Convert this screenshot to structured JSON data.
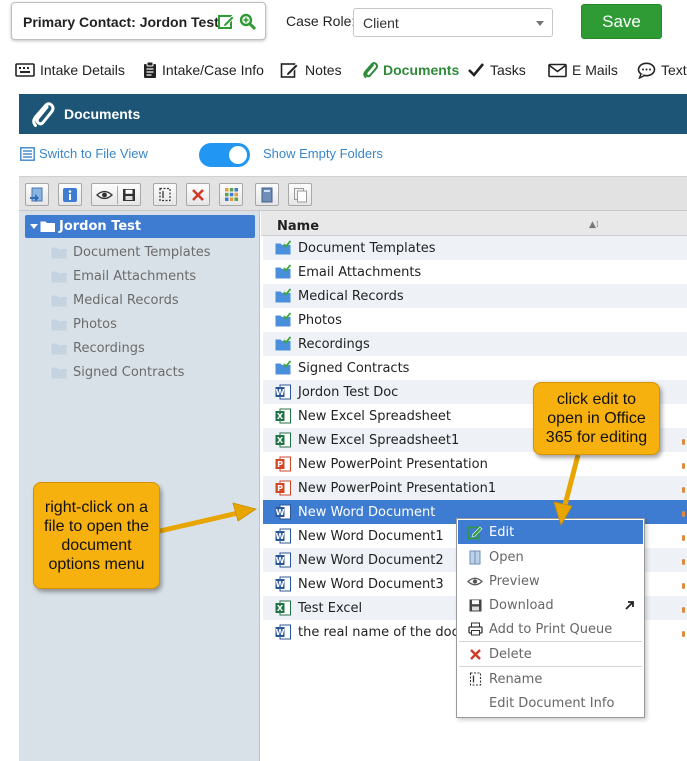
{
  "header": {
    "primary_contact": "Primary Contact: Jordon Test",
    "case_role_label": "Case Role:",
    "case_role_value": "Client",
    "save_label": "Save"
  },
  "tabs": [
    {
      "label": "Intake Details",
      "icon": "keyboard-icon"
    },
    {
      "label": "Intake/Case Info",
      "icon": "clipboard-icon"
    },
    {
      "label": "Notes",
      "icon": "note-edit-icon"
    },
    {
      "label": "Documents",
      "icon": "paperclip-icon",
      "active": true
    },
    {
      "label": "Tasks",
      "icon": "checkmark-icon"
    },
    {
      "label": "E Mails",
      "icon": "envelope-icon"
    },
    {
      "label": "Texts",
      "icon": "chat-bubble-icon"
    }
  ],
  "panel": {
    "title": "Documents",
    "switch_view": "Switch to File View",
    "show_empty": "Show Empty Folders",
    "show_empty_on": true
  },
  "tree": {
    "root": "Jordon Test",
    "items": [
      "Document Templates",
      "Email Attachments",
      "Medical Records",
      "Photos",
      "Recordings",
      "Signed Contracts"
    ]
  },
  "list": {
    "column_name": "Name",
    "rows": [
      {
        "name": "Document Templates",
        "type": "folder"
      },
      {
        "name": "Email Attachments",
        "type": "folder"
      },
      {
        "name": "Medical Records",
        "type": "folder"
      },
      {
        "name": "Photos",
        "type": "folder"
      },
      {
        "name": "Recordings",
        "type": "folder"
      },
      {
        "name": "Signed Contracts",
        "type": "folder"
      },
      {
        "name": "Jordon Test Doc",
        "type": "word"
      },
      {
        "name": "New Excel Spreadsheet",
        "type": "excel"
      },
      {
        "name": "New Excel Spreadsheet1",
        "type": "excel"
      },
      {
        "name": "New PowerPoint Presentation",
        "type": "powerpoint"
      },
      {
        "name": "New PowerPoint Presentation1",
        "type": "powerpoint"
      },
      {
        "name": "New Word Document",
        "type": "word",
        "selected": true
      },
      {
        "name": "New Word Document1",
        "type": "word"
      },
      {
        "name": "New Word Document2",
        "type": "word"
      },
      {
        "name": "New Word Document3",
        "type": "word"
      },
      {
        "name": "Test Excel",
        "type": "excel"
      },
      {
        "name": "the real name of the doc",
        "type": "word"
      }
    ]
  },
  "context_menu": {
    "items": [
      {
        "label": "Edit",
        "icon": "edit-icon",
        "selected": true
      },
      {
        "label": "Open",
        "icon": "open-book-icon"
      },
      {
        "label": "Preview",
        "icon": "eye-icon"
      },
      {
        "label": "Download",
        "icon": "save-disk-icon"
      },
      {
        "label": "Add to Print Queue",
        "icon": "printer-icon"
      },
      {
        "label": "Delete",
        "icon": "x-icon"
      },
      {
        "label": "Rename",
        "icon": "rename-icon"
      },
      {
        "label": "Edit Document Info",
        "icon": ""
      }
    ]
  },
  "callouts": {
    "right_click": "right-click on a file to open the document options menu",
    "edit": "click edit to open in Office 365 for editing"
  },
  "colors": {
    "accent_green": "#2e9b35",
    "panel_header": "#1c5575",
    "selection_blue": "#3d7cd1",
    "callout_orange": "#f7b10f",
    "link_blue": "#3a86c8"
  }
}
